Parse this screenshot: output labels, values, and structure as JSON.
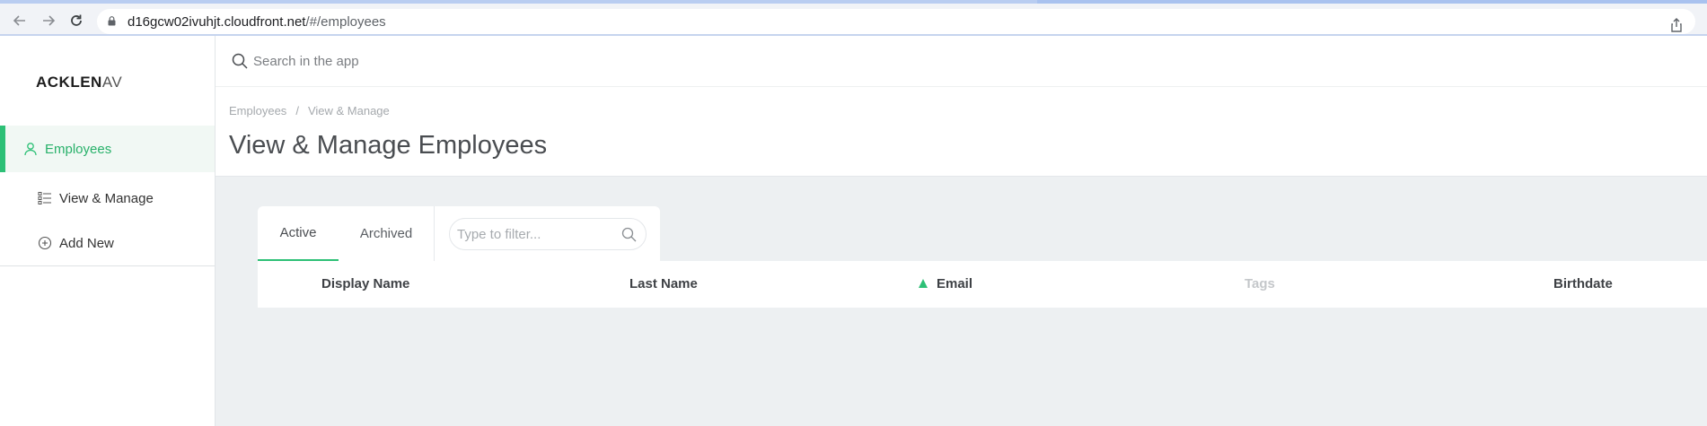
{
  "browser": {
    "url_host": "d16gcw02ivuhjt.cloudfront.net",
    "url_path": "/#/employees"
  },
  "sidebar": {
    "logo_bold": "ACKLEN",
    "logo_light": "AV",
    "items": [
      {
        "label": "Employees",
        "icon": "user-icon",
        "active": true
      },
      {
        "label": "View & Manage",
        "icon": "list-icon",
        "active": false
      },
      {
        "label": "Add New",
        "icon": "plus-circle-icon",
        "active": false
      }
    ]
  },
  "search": {
    "placeholder": "Search in the app"
  },
  "breadcrumb": [
    "Employees",
    "/",
    "View & Manage"
  ],
  "page": {
    "title": "View & Manage Employees"
  },
  "tabs": [
    {
      "label": "Active",
      "active": true
    },
    {
      "label": "Archived",
      "active": false
    }
  ],
  "filter": {
    "placeholder": "Type to filter..."
  },
  "table": {
    "columns": [
      "Display Name",
      "Last Name",
      "Email",
      "Tags",
      "Birthdate"
    ],
    "sorted_column": "Email",
    "sort_direction": "ascending"
  },
  "colors": {
    "accent": "#2dc076",
    "active_bg": "#f1f8f4",
    "content_bg": "#edf0f2"
  }
}
